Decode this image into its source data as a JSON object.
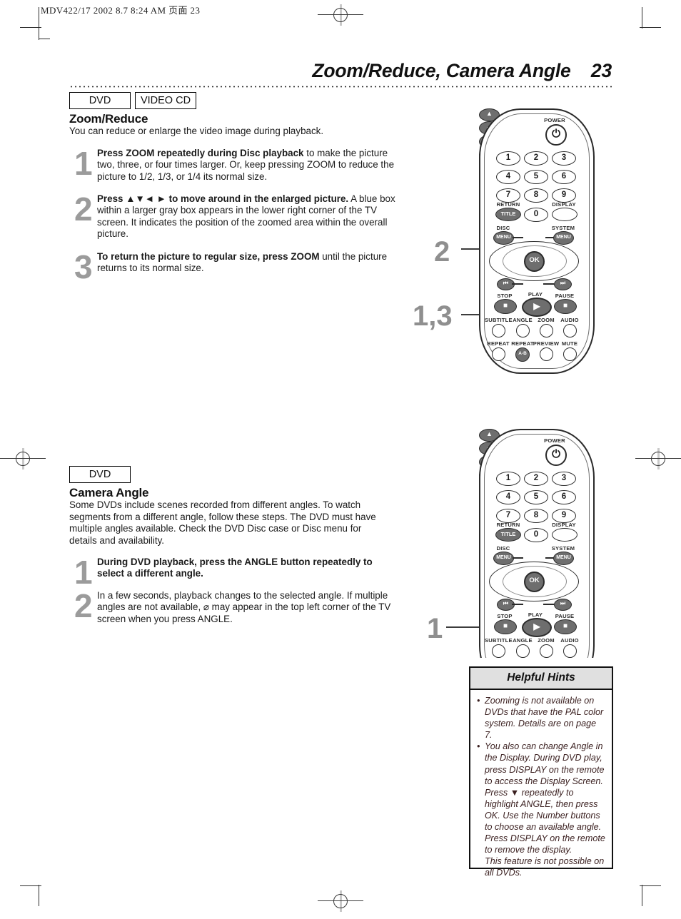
{
  "print_slug": "MDV422/17  2002 8.7  8:24 AM  页面 23",
  "header": {
    "title": "Zoom/Reduce, Camera Angle",
    "page_number": "23"
  },
  "sections": [
    {
      "badges": [
        "DVD",
        "VIDEO CD"
      ],
      "heading": "Zoom/Reduce",
      "intro": "You can reduce or enlarge the video image during playback.",
      "steps": [
        {
          "number": "1",
          "bold": "Press ZOOM repeatedly during Disc playback",
          "rest": " to make the picture two, three, or four times larger. Or, keep pressing ZOOM to reduce the picture to 1/2, 1/3, or 1/4 its normal size."
        },
        {
          "number": "2",
          "bold": "Press ▲▼◄ ► to move around in the enlarged picture.",
          "rest": " A blue box within a larger gray box appears in the lower right corner of the TV screen. It indicates the position of the zoomed area within the overall picture."
        },
        {
          "number": "3",
          "bold": "To return the picture to regular size, press ZOOM",
          "rest": " until the picture returns to its normal size."
        }
      ],
      "callouts": [
        "2",
        "1,3"
      ]
    },
    {
      "badges": [
        "DVD"
      ],
      "heading": "Camera Angle",
      "intro": "Some DVDs include scenes recorded from different angles. To watch segments from a different angle, follow these steps. The DVD must have multiple angles available. Check the DVD Disc case or Disc menu for details and availability.",
      "steps": [
        {
          "number": "1",
          "bold": "During DVD playback, press the ANGLE button repeatedly to select a different angle.",
          "rest": ""
        },
        {
          "number": "2",
          "bold": "",
          "rest": "In a few seconds, playback changes to the selected angle. If multiple angles are not available, ⌀ may appear in the top left corner of the TV screen when you press ANGLE."
        }
      ],
      "callouts": [
        "1"
      ]
    }
  ],
  "remote": {
    "power_label": "POWER",
    "power_glyph": "⏻",
    "number_keys": [
      "1",
      "2",
      "3",
      "4",
      "5",
      "6",
      "7",
      "8",
      "9",
      "0"
    ],
    "return_label": "RETURN",
    "title_key": "TITLE",
    "display_label": "DISPLAY",
    "disc_label": "DISC",
    "system_label": "SYSTEM",
    "menu_key": "MENU",
    "up_glyph": "▲",
    "down_glyph": "▼",
    "left_glyph": "◀",
    "right_glyph": "▶",
    "ok_key": "OK",
    "prev_glyph": "⏮",
    "next_glyph": "⏭",
    "stop_label": "STOP",
    "play_label": "PLAY",
    "pause_label": "PAUSE",
    "stop_glyph": "■",
    "play_glyph": "▶",
    "pause_glyph": "■",
    "function_row1": [
      "SUBTITLE",
      "ANGLE",
      "ZOOM",
      "AUDIO"
    ],
    "function_row2": [
      "REPEAT",
      "REPEAT",
      "PREVIEW",
      "MUTE"
    ],
    "ab_key": "A-B"
  },
  "helpful_hints": {
    "title": "Helpful Hints",
    "bullet": "•",
    "items": [
      "Zooming is not available on DVDs that have the PAL color system. Details are on page 7.",
      "You also can change Angle in the Display. During DVD play, press DISPLAY on the remote to access the Display Screen. Press ▼ repeatedly to highlight ANGLE, then press OK. Use the Number buttons to choose an available angle. Press DISPLAY on the remote to remove the display.\nThis feature is not  possible on all DVDs."
    ]
  }
}
